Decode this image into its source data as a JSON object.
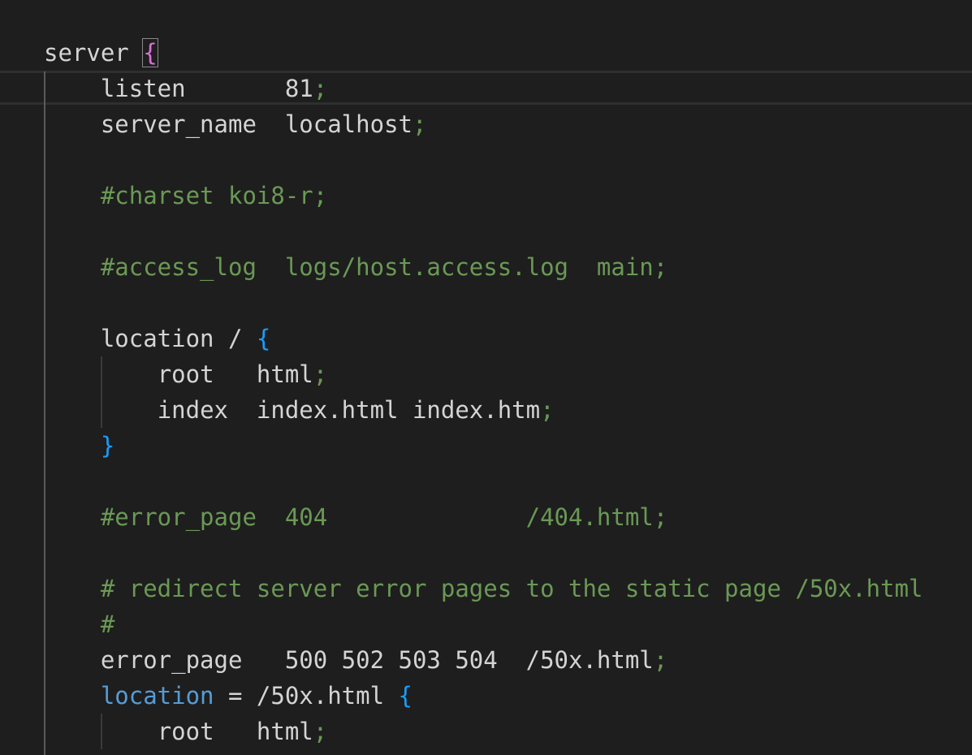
{
  "editor": {
    "lines": [
      {
        "indent": "",
        "tokens": [
          {
            "t": "server ",
            "c": "t-kw"
          },
          {
            "t": "{",
            "c": "t-brace-pink bracket-match"
          }
        ]
      },
      {
        "indent": "    ",
        "tokens": [
          {
            "t": "listen       81",
            "c": "t-kw"
          },
          {
            "t": ";",
            "c": "t-semi"
          }
        ]
      },
      {
        "indent": "    ",
        "tokens": [
          {
            "t": "server_name  localhost",
            "c": "t-kw"
          },
          {
            "t": ";",
            "c": "t-semi"
          }
        ]
      },
      {
        "indent": "",
        "tokens": []
      },
      {
        "indent": "    ",
        "tokens": [
          {
            "t": "#charset koi8-r;",
            "c": "t-comment"
          }
        ]
      },
      {
        "indent": "",
        "tokens": []
      },
      {
        "indent": "    ",
        "tokens": [
          {
            "t": "#access_log  logs/host.access.log  main;",
            "c": "t-comment"
          }
        ]
      },
      {
        "indent": "",
        "tokens": []
      },
      {
        "indent": "    ",
        "tokens": [
          {
            "t": "location / ",
            "c": "t-kw"
          },
          {
            "t": "{",
            "c": "t-brace-blue"
          }
        ]
      },
      {
        "indent": "        ",
        "tokens": [
          {
            "t": "root   html",
            "c": "t-kw"
          },
          {
            "t": ";",
            "c": "t-semi"
          }
        ]
      },
      {
        "indent": "        ",
        "tokens": [
          {
            "t": "index  index.html index.htm",
            "c": "t-kw"
          },
          {
            "t": ";",
            "c": "t-semi"
          }
        ]
      },
      {
        "indent": "    ",
        "tokens": [
          {
            "t": "}",
            "c": "t-brace-blue"
          }
        ]
      },
      {
        "indent": "",
        "tokens": []
      },
      {
        "indent": "    ",
        "tokens": [
          {
            "t": "#error_page  404              /404.html;",
            "c": "t-comment"
          }
        ]
      },
      {
        "indent": "",
        "tokens": []
      },
      {
        "indent": "    ",
        "tokens": [
          {
            "t": "# redirect server error pages to the static page /50x.html",
            "c": "t-comment"
          }
        ]
      },
      {
        "indent": "    ",
        "tokens": [
          {
            "t": "#",
            "c": "t-comment"
          }
        ]
      },
      {
        "indent": "    ",
        "tokens": [
          {
            "t": "error_page   500 502 503 504  /50x.html",
            "c": "t-kw"
          },
          {
            "t": ";",
            "c": "t-semi"
          }
        ]
      },
      {
        "indent": "    ",
        "tokens": [
          {
            "t": "location",
            "c": "t-loc-blue"
          },
          {
            "t": " = /50x.html ",
            "c": "t-kw"
          },
          {
            "t": "{",
            "c": "t-brace-blue"
          }
        ]
      },
      {
        "indent": "        ",
        "tokens": [
          {
            "t": "root   html",
            "c": "t-kw"
          },
          {
            "t": ";",
            "c": "t-semi"
          }
        ]
      }
    ]
  },
  "colors": {
    "background": "#1e1e1e",
    "text": "#d4d4d4",
    "comment": "#6a9955",
    "brace_outer": "#da70d6",
    "brace_inner": "#179fff",
    "keyword_blue": "#569cd6"
  }
}
